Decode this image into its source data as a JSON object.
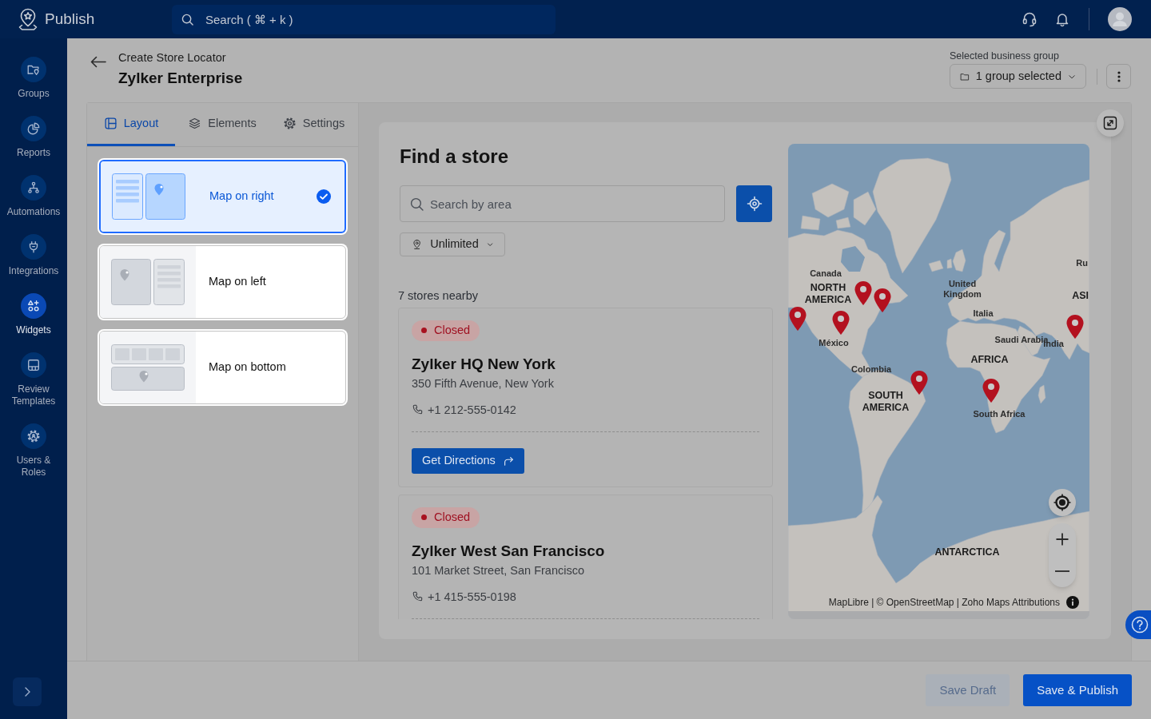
{
  "app": {
    "name": "Publish",
    "search_placeholder": "Search ( ⌘ + k )"
  },
  "sidebar": {
    "items": [
      {
        "label": "Groups",
        "selected": false
      },
      {
        "label": "Reports",
        "selected": false
      },
      {
        "label": "Automations",
        "selected": false
      },
      {
        "label": "Integrations",
        "selected": false
      },
      {
        "label": "Widgets",
        "selected": true
      },
      {
        "label": "Review Templates",
        "selected": false
      },
      {
        "label": "Users & Roles",
        "selected": false
      }
    ]
  },
  "header": {
    "breadcrumb": "Create Store Locator",
    "title": "Zylker Enterprise",
    "group_label": "Selected business group",
    "group_value": "1 group selected"
  },
  "tabs": [
    {
      "label": "Layout",
      "selected": true
    },
    {
      "label": "Elements",
      "selected": false
    },
    {
      "label": "Settings",
      "selected": false
    }
  ],
  "layouts": [
    {
      "kind": "right",
      "label": "Map on right",
      "selected": true
    },
    {
      "kind": "left",
      "label": "Map on left",
      "selected": false
    },
    {
      "kind": "bottom",
      "label": "Map on bottom",
      "selected": false
    }
  ],
  "preview": {
    "title": "Find a store",
    "search_placeholder": "Search by area",
    "radius": "Unlimited",
    "count": "7 stores nearby",
    "stores": [
      {
        "status": "Closed",
        "name": "Zylker HQ New York",
        "address": "350 Fifth Avenue, New York",
        "phone": "+1 212-555-0142",
        "action": "Get Directions"
      },
      {
        "status": "Closed",
        "name": "Zylker West San Francisco",
        "address": "101 Market Street, San Francisco",
        "phone": "+1 415-555-0198"
      }
    ],
    "map": {
      "labels": [
        {
          "kind": "country",
          "text": "Ru"
        },
        {
          "kind": "country",
          "text": "Canada"
        },
        {
          "kind": "continent",
          "text": "NORTH AMERICA"
        },
        {
          "kind": "country",
          "text": "United Kingdom"
        },
        {
          "kind": "continent",
          "text": "ASI"
        },
        {
          "kind": "country",
          "text": "Italia"
        },
        {
          "kind": "country",
          "text": "Saudi Arabia"
        },
        {
          "kind": "country",
          "text": "México"
        },
        {
          "kind": "country",
          "text": "India"
        },
        {
          "kind": "continent",
          "text": "AFRICA"
        },
        {
          "kind": "country",
          "text": "Colombia"
        },
        {
          "kind": "continent",
          "text": "SOUTH AMERICA"
        },
        {
          "kind": "country",
          "text": "South Africa"
        },
        {
          "kind": "continent",
          "text": "ANTARCTICA"
        }
      ],
      "attribution": "MapLibre | © OpenStreetMap | Zoho Maps Attributions"
    }
  },
  "footer": {
    "buttons": [
      {
        "label": "Save Draft",
        "disabled": true
      },
      {
        "label": "Save & Publish",
        "disabled": false
      }
    ]
  }
}
